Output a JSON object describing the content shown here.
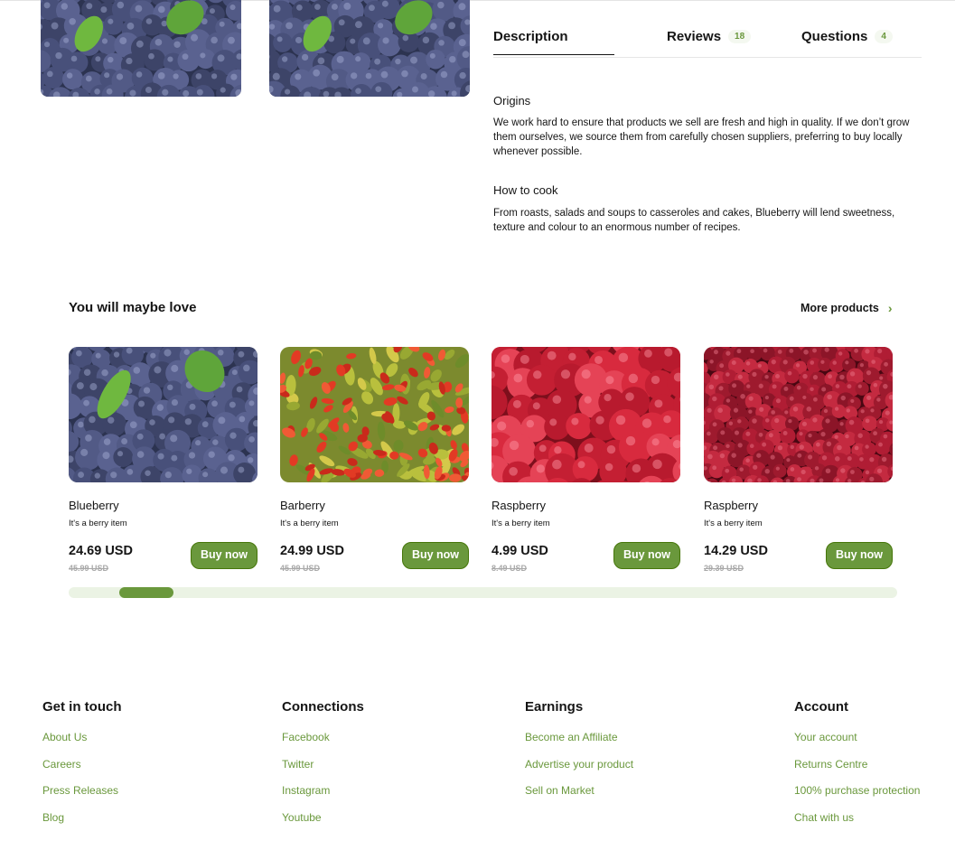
{
  "tabs": [
    {
      "label": "Description",
      "count": ""
    },
    {
      "label": "Reviews",
      "count": "18"
    },
    {
      "label": "Questions",
      "count": "4"
    }
  ],
  "description": {
    "origins_title": "Origins",
    "origins_text": "We work hard to ensure that products we sell are fresh and high in quality. If we don’t grow them ourselves, we source them from carefully chosen suppliers, preferring to buy locally whenever possible.",
    "cook_title": "How to cook",
    "cook_text": "From roasts, salads and soups to casseroles and cakes, Blueberry will lend sweetness, texture and colour to an enormous number of recipes."
  },
  "related": {
    "title": "You will maybe love",
    "more_label": "More products",
    "carousel_position": 0.065,
    "products": [
      {
        "name": "Blueberry",
        "desc": "It's a berry item",
        "price": "24.69 USD",
        "old_price": "45.99 USD",
        "buy_label": "Buy now",
        "image": "blueberries"
      },
      {
        "name": "Barberry",
        "desc": "It's a berry item",
        "price": "24.99 USD",
        "old_price": "45.99 USD",
        "buy_label": "Buy now",
        "image": "barberries"
      },
      {
        "name": "Raspberry",
        "desc": "It's a berry item",
        "price": "4.99 USD",
        "old_price": "8.49 USD",
        "buy_label": "Buy now",
        "image": "raspberries-closeup"
      },
      {
        "name": "Raspberry",
        "desc": "It's a berry item",
        "price": "14.29 USD",
        "old_price": "29.39 USD",
        "buy_label": "Buy now",
        "image": "raspberries-pile"
      }
    ]
  },
  "footer": {
    "columns": [
      {
        "title": "Get in touch",
        "links": [
          "About Us",
          "Careers",
          "Press Releases",
          "Blog"
        ]
      },
      {
        "title": "Connections",
        "links": [
          "Facebook",
          "Twitter",
          "Instagram",
          "Youtube"
        ]
      },
      {
        "title": "Earnings",
        "links": [
          "Become an Affiliate",
          "Advertise your product",
          "Sell on Market"
        ]
      },
      {
        "title": "Account",
        "links": [
          "Your account",
          "Returns Centre",
          "100% purchase protection",
          "Chat with us"
        ]
      }
    ]
  },
  "colors": {
    "accent": "#6a983c",
    "accent_dark": "#46760a",
    "text": "#151515",
    "muted": "#a9a9a9"
  }
}
